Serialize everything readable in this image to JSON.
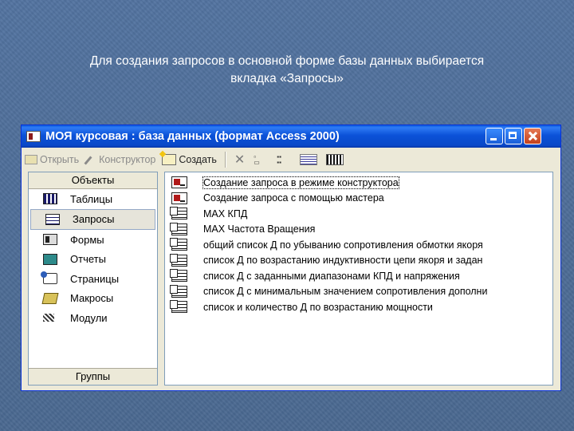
{
  "caption": {
    "line1": "Для создания запросов в основной форме базы данных выбирается",
    "line2": "вкладка «Запросы»"
  },
  "window": {
    "title": "МОЯ курсовая : база данных (формат Access 2000)",
    "buttons": [
      "minimize",
      "maximize",
      "close"
    ]
  },
  "toolbar": {
    "open_label": "Открыть",
    "design_label": "Конструктор",
    "create_label": "Создать"
  },
  "objects": {
    "header": "Объекты",
    "items": [
      {
        "label": "Таблицы",
        "icon": "table-icon"
      },
      {
        "label": "Запросы",
        "icon": "query-icon",
        "selected": true
      },
      {
        "label": "Формы",
        "icon": "form-icon"
      },
      {
        "label": "Отчеты",
        "icon": "report-icon"
      },
      {
        "label": "Страницы",
        "icon": "page-icon"
      },
      {
        "label": "Макросы",
        "icon": "macro-icon"
      },
      {
        "label": "Модули",
        "icon": "module-icon"
      }
    ],
    "groups_label": "Группы"
  },
  "queries": [
    {
      "label": "Создание запроса в режиме конструктора",
      "icon": "wizard-icon"
    },
    {
      "label": "Создание запроса с помощью мастера",
      "icon": "wizard-icon"
    },
    {
      "label": "MAX КПД",
      "icon": "query-icon"
    },
    {
      "label": "MAX Частота Вращения",
      "icon": "query-icon"
    },
    {
      "label": "общий список Д по убыванию сопротивления обмотки якоря",
      "icon": "query-icon"
    },
    {
      "label": "список Д по возрастанию индуктивности цепи якоря и задан",
      "icon": "query-icon"
    },
    {
      "label": "список Д с заданными диапазонами КПД и напряжения",
      "icon": "query-icon"
    },
    {
      "label": "список Д с минимальным значением сопротивления дополни",
      "icon": "query-icon"
    },
    {
      "label": "список и количество Д  по возрастанию мощности",
      "icon": "query-icon"
    }
  ]
}
